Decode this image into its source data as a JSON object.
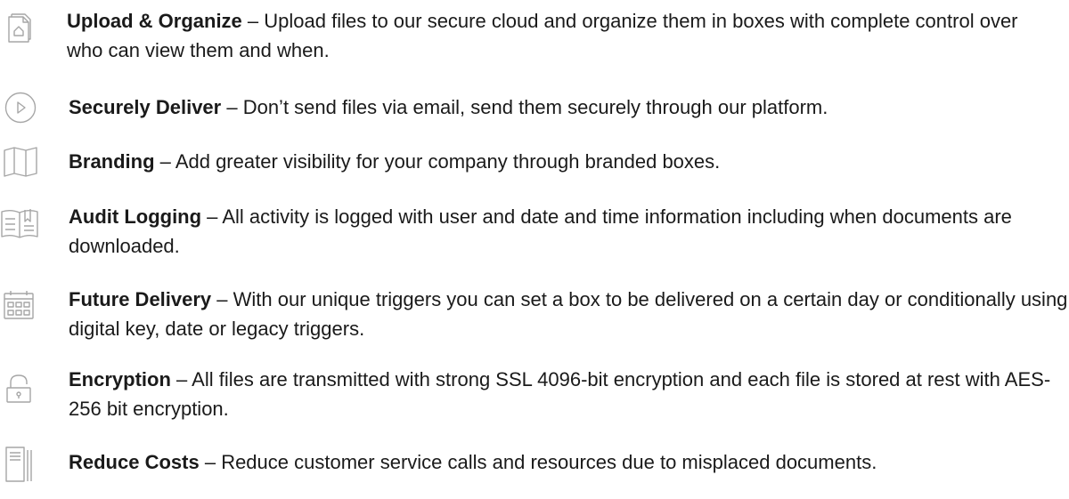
{
  "features": [
    {
      "icon": "upload-document-icon",
      "title": "Upload & Organize",
      "separator": " – ",
      "description": "Upload files to our secure cloud and organize them in boxes with complete control over who can view them and when."
    },
    {
      "icon": "play-circle-icon",
      "title": "Securely Deliver",
      "separator": " – ",
      "description": "Don’t send files via email, send them securely through our platform."
    },
    {
      "icon": "map-icon",
      "title": "Branding",
      "separator": " – ",
      "description": "Add greater visibility for your company through branded boxes."
    },
    {
      "icon": "open-book-icon",
      "title": "Audit Logging",
      "separator": " – ",
      "description": "All activity is logged with user and date and time information including when documents are downloaded."
    },
    {
      "icon": "calendar-icon",
      "title": "Future Delivery",
      "separator": " – ",
      "description": "With our unique triggers you can set a box to be delivered on a certain day or conditionally using digital key, date or legacy triggers."
    },
    {
      "icon": "lock-icon",
      "title": "Encryption",
      "separator": " – ",
      "description": "All files are transmitted with strong SSL 4096-bit encryption and each file is stored at rest with AES-256 bit encryption."
    },
    {
      "icon": "files-icon",
      "title": "Reduce Costs",
      "separator": " – ",
      "description": "Reduce customer service calls and resources due to misplaced documents."
    }
  ],
  "colors": {
    "text": "#1a1a1a",
    "icon_stroke": "#a6a6a6"
  }
}
